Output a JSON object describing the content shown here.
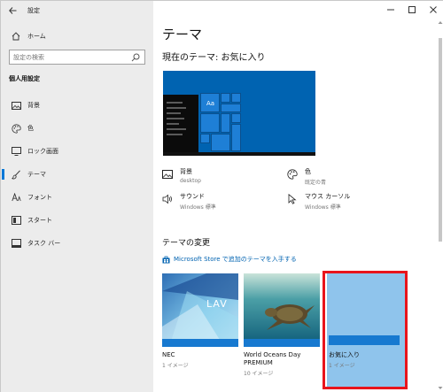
{
  "app": {
    "title": "設定"
  },
  "sidebar": {
    "home": "ホーム",
    "search_placeholder": "設定の検索",
    "section": "個人用設定",
    "items": [
      {
        "label": "背景",
        "icon": "picture-icon"
      },
      {
        "label": "色",
        "icon": "palette-icon"
      },
      {
        "label": "ロック画面",
        "icon": "monitor-icon"
      },
      {
        "label": "テーマ",
        "icon": "brush-icon",
        "active": true
      },
      {
        "label": "フォント",
        "icon": "font-icon"
      },
      {
        "label": "スタート",
        "icon": "start-icon"
      },
      {
        "label": "タスク バー",
        "icon": "taskbar-icon"
      }
    ]
  },
  "main": {
    "title": "テーマ",
    "current_theme": "現在のテーマ: お気に入り",
    "preview_sample": "Aa",
    "properties": [
      {
        "title": "背景",
        "sub": "desktop",
        "icon": "picture-icon"
      },
      {
        "title": "色",
        "sub": "既定の青",
        "icon": "palette-icon"
      },
      {
        "title": "サウンド",
        "sub": "Windows 標準",
        "icon": "speaker-icon"
      },
      {
        "title": "マウス カーソル",
        "sub": "Windows 標準",
        "icon": "cursor-icon"
      }
    ],
    "change_heading": "テーマの変更",
    "store_link": "Microsoft Store で追加のテーマを入手する",
    "themes": [
      {
        "name": "NEC",
        "count": "1 イメージ",
        "thumb_text": "LAV"
      },
      {
        "name": "World Oceans Day PREMIUM",
        "count": "10 イメージ"
      },
      {
        "name": "お気に入り",
        "count": "1 イメージ",
        "selected": true
      }
    ]
  },
  "colors": {
    "accent": "#0078d7",
    "link": "#0063b1",
    "highlight": "#e8141c"
  }
}
